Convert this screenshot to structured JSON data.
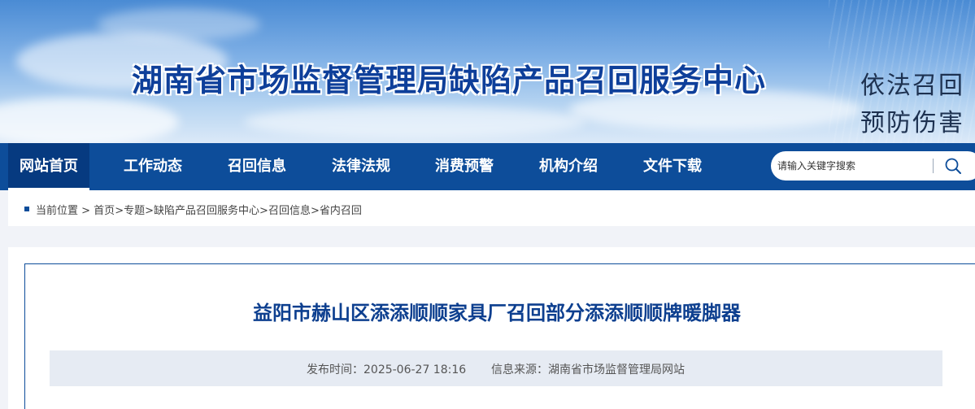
{
  "banner": {
    "title": "湖南省市场监督管理局缺陷产品召回服务中心",
    "slogan_line1": "依法召回",
    "slogan_line2": "预防伤害"
  },
  "nav": {
    "items": [
      {
        "label": "网站首页",
        "active": true
      },
      {
        "label": "工作动态",
        "active": false
      },
      {
        "label": "召回信息",
        "active": false
      },
      {
        "label": "法律法规",
        "active": false
      },
      {
        "label": "消费预警",
        "active": false
      },
      {
        "label": "机构介绍",
        "active": false
      },
      {
        "label": "文件下载",
        "active": false
      }
    ],
    "search": {
      "placeholder": "请输入关键字搜索",
      "icon": "search-icon"
    }
  },
  "breadcrumb": {
    "prefix": "当前位置 >",
    "items": [
      "首页",
      "专题",
      "缺陷产品召回服务中心",
      "召回信息",
      "省内召回"
    ],
    "separator": ">"
  },
  "article": {
    "title": "益阳市赫山区添添顺顺家具厂召回部分添添顺顺牌暖脚器",
    "publish_time_label": "发布时间：",
    "publish_time": "2025-06-27 18:16",
    "source_label": "信息来源：",
    "source": "湖南省市场监督管理局网站"
  },
  "colors": {
    "nav_bg": "#0d4d9a",
    "title_blue": "#0d3f8f",
    "meta_bg": "#e6ebf3"
  }
}
